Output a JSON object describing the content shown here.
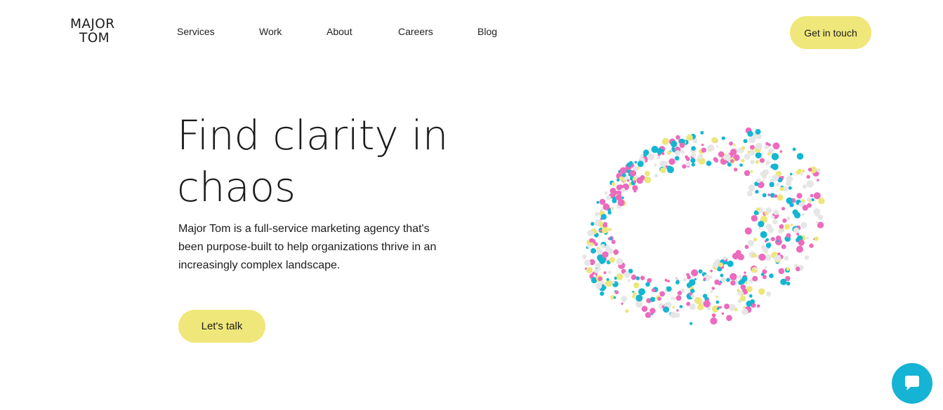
{
  "logo": {
    "line1": "MAJOR",
    "line2": "TOM"
  },
  "nav": {
    "items": [
      {
        "label": "Services"
      },
      {
        "label": "Work"
      },
      {
        "label": "About"
      },
      {
        "label": "Careers"
      },
      {
        "label": "Blog"
      }
    ]
  },
  "header": {
    "cta_label": "Get in touch"
  },
  "hero": {
    "title_line1": "Find clarity in",
    "title_line2": "chaos",
    "subtitle": "Major Tom is a full-service marketing agency that's been purpose-built to help organizations thrive in an increasingly complex landscape.",
    "cta_label": "Let's talk"
  },
  "particles": {
    "colors": [
      "#ec6bbd",
      "#14b6d1",
      "#ede67a",
      "#e6e6e6"
    ]
  },
  "chat": {
    "icon": "chat-bubble-icon"
  },
  "colors": {
    "accent": "#f0e77a",
    "chat": "#15b3d4",
    "text": "#1c1c1c"
  }
}
